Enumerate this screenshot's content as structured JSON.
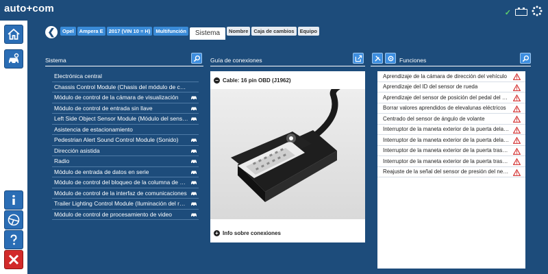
{
  "app": {
    "logo": "auto+com"
  },
  "status": {
    "connected_mark": "✓"
  },
  "breadcrumb": {
    "items": [
      "Opel",
      "Ampera E",
      "2017 (VIN 10 = H)",
      "Multifunción"
    ],
    "active": "Sistema",
    "tabs": [
      "Nombre",
      "Caja de cambios",
      "Equipo"
    ]
  },
  "sistema": {
    "title": "Sistema",
    "items": [
      {
        "label": "Electrónica central",
        "has_car": false
      },
      {
        "label": "Chassis Control Module (Chasis del módulo de control)",
        "has_car": false
      },
      {
        "label": "Módulo de control de la cámara de visualización",
        "has_car": true
      },
      {
        "label": "Módulo de control de entrada sin llave",
        "has_car": true
      },
      {
        "label": "Left Side Object Sensor Module (Módulo del sensor)",
        "has_car": true
      },
      {
        "label": "Asistencia de estacionamiento",
        "has_car": false
      },
      {
        "label": "Pedestrian Alert Sound Control Module (Sonido)",
        "has_car": true
      },
      {
        "label": "Dirección asistida",
        "has_car": true
      },
      {
        "label": "Radio",
        "has_car": true
      },
      {
        "label": "Módulo de entrada de datos en serie",
        "has_car": true
      },
      {
        "label": "Módulo de control del bloqueo de la columna de dirección",
        "has_car": true
      },
      {
        "label": "Módulo de control de la interfaz de comunicaciones",
        "has_car": true
      },
      {
        "label": "Trailer Lighting Control Module (Iluminación del remolque)",
        "has_car": true
      },
      {
        "label": "Módulo de control de procesamiento de video",
        "has_car": true
      }
    ]
  },
  "guia": {
    "title": "Guía de conexiones",
    "cable_label": "Cable: 16 pin OBD (J1962)",
    "info_label": "Info sobre conexiones"
  },
  "funciones": {
    "title": "Funciones",
    "items": [
      "Aprendizaje de la cámara de dirección del vehículo",
      "Aprendizaje del ID del sensor de rueda",
      "Aprendizaje del sensor de posición del pedal del acelerador",
      "Borrar valores aprendidos de elevalunas eléctricos",
      "Centrado del sensor de ángulo de volante",
      "Interruptor de la maneta exterior de la puerta delantera izquierda",
      "Interruptor de la maneta exterior de la puerta delantera derecha",
      "Interruptor de la maneta exterior de la puerta trasera izquierda",
      "Interruptor de la maneta exterior de la puerta trasera derecha",
      "Reajuste de la señal del sensor de presión del neumático"
    ]
  },
  "colors": {
    "background": "#1d4c7b",
    "accent": "#3a8bd8",
    "warning": "#d22a2a"
  }
}
